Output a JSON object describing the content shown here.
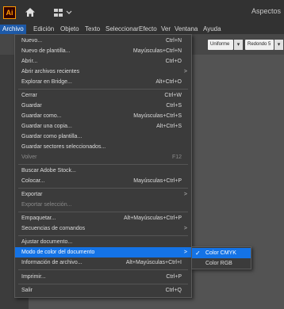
{
  "appbar": {
    "logo": "Ai",
    "right_text": "Aspectos",
    "workspace_chevron": "⌄"
  },
  "menubar": {
    "items": [
      "Archivo",
      "Edición",
      "Objeto",
      "Texto",
      "Seleccionar",
      "Efecto",
      "Ver",
      "Ventana",
      "Ayuda"
    ]
  },
  "controlbar": {
    "stroke_profile": "Uniforme",
    "brush": "Redondo 5 ...",
    "dropdown_glyph": "▾"
  },
  "file_menu": {
    "items": [
      {
        "label": "Nuevo...",
        "shortcut": "Ctrl+N"
      },
      {
        "label": "Nuevo de plantilla...",
        "shortcut": "Mayúsculas+Ctrl+N"
      },
      {
        "label": "Abrir...",
        "shortcut": "Ctrl+O"
      },
      {
        "label": "Abrir archivos recientes",
        "submenu": ">"
      },
      {
        "label": "Explorar en Bridge...",
        "shortcut": "Alt+Ctrl+O"
      },
      {
        "label": "Cerrar",
        "shortcut": "Ctrl+W"
      },
      {
        "label": "Guardar",
        "shortcut": "Ctrl+S"
      },
      {
        "label": "Guardar como...",
        "shortcut": "Mayúsculas+Ctrl+S"
      },
      {
        "label": "Guardar una copia...",
        "shortcut": "Alt+Ctrl+S"
      },
      {
        "label": "Guardar como plantilla..."
      },
      {
        "label": "Guardar sectores seleccionados..."
      },
      {
        "label": "Volver",
        "shortcut": "F12",
        "disabled": true
      },
      {
        "label": "Buscar Adobe Stock..."
      },
      {
        "label": "Colocar...",
        "shortcut": "Mayúsculas+Ctrl+P"
      },
      {
        "label": "Exportar",
        "submenu": ">"
      },
      {
        "label": "Exportar selección...",
        "disabled": true
      },
      {
        "label": "Empaquetar...",
        "shortcut": "Alt+Mayúsculas+Ctrl+P"
      },
      {
        "label": "Secuencias de comandos",
        "submenu": ">"
      },
      {
        "label": "Ajustar documento..."
      },
      {
        "label": "Modo de color del documento",
        "submenu": ">",
        "highlight": true
      },
      {
        "label": "Información de archivo...",
        "shortcut": "Alt+Mayúsculas+Ctrl+I"
      },
      {
        "label": "Imprimir...",
        "shortcut": "Ctrl+P"
      },
      {
        "label": "Salir",
        "shortcut": "Ctrl+Q"
      }
    ]
  },
  "color_mode_submenu": {
    "items": [
      {
        "label": "Color CMYK",
        "checked": true
      },
      {
        "label": "Color RGB",
        "checked": false
      }
    ],
    "check_glyph": "✓"
  }
}
